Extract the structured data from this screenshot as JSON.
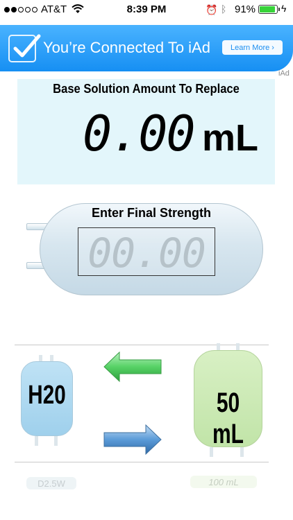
{
  "status_bar": {
    "carrier": "AT&T",
    "time": "8:39 PM",
    "battery_percent": "91%",
    "battery_level": 0.91,
    "signal_bars_filled": 2,
    "signal_bars_total": 5,
    "icons": [
      "wifi-icon",
      "alarm-icon",
      "bluetooth-icon",
      "battery-icon",
      "charging-icon"
    ]
  },
  "iad_banner": {
    "message": "You’re Connected To iAd",
    "button_label": "Learn More ›",
    "brand": "iAd",
    "color": "#1b8ef0"
  },
  "result": {
    "title": "Base Solution Amount To Replace",
    "value": "0.00",
    "unit": "mL",
    "background": "#e3f6fb"
  },
  "strength": {
    "title": "Enter Final Strength",
    "value": "00.00"
  },
  "bags": {
    "diluent": {
      "label": "H20",
      "color": "#a9d7f0"
    },
    "volume": {
      "label": "50 mL",
      "color": "#c9e9b2"
    },
    "next_diluent": "D2.5W",
    "next_volume": "100 mL"
  },
  "arrows": {
    "left": {
      "icon": "arrow-left-icon",
      "color": "#5bd368"
    },
    "right": {
      "icon": "arrow-right-icon",
      "color": "#5b9bd8"
    }
  }
}
